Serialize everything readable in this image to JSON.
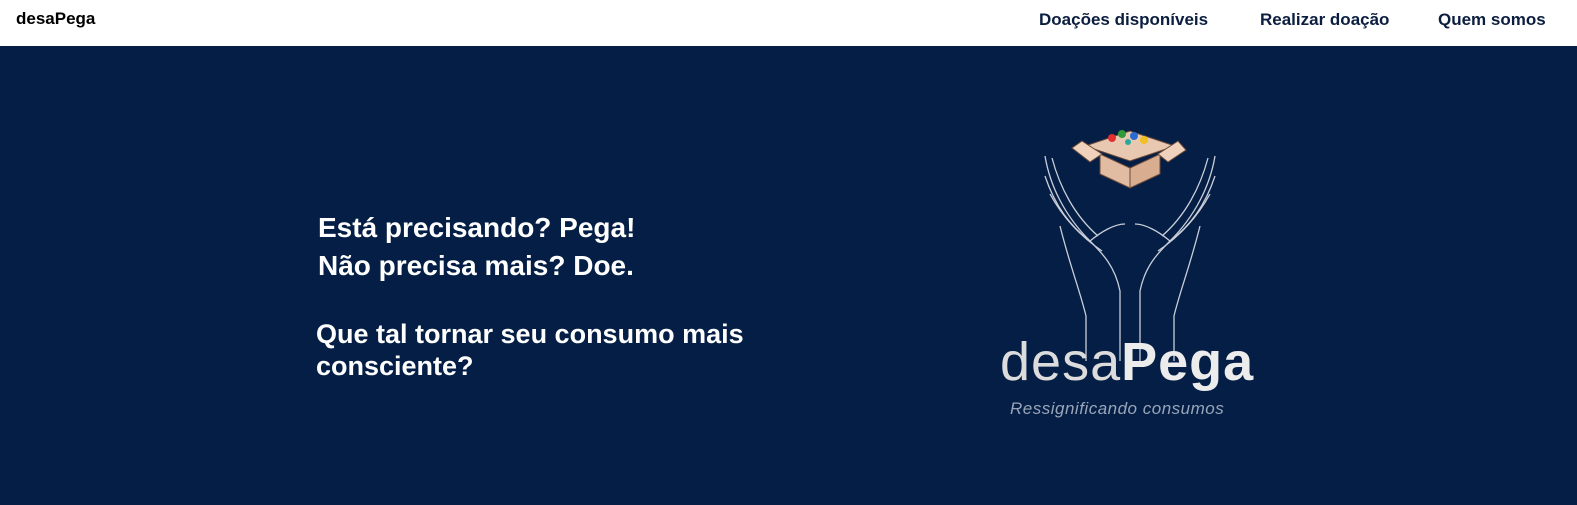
{
  "navbar": {
    "brand": "desaPega",
    "links": [
      "Doações disponíveis",
      "Realizar doação",
      "Quem somos"
    ]
  },
  "hero": {
    "headline_line1": "Está precisando? Pega!",
    "headline_line2": "Não precisa mais? Doe.",
    "subline": "Que tal tornar seu consumo mais consciente?"
  },
  "logo": {
    "word_light": "desa",
    "word_bold": "Pega",
    "tagline": "Ressignificando consumos"
  },
  "colors": {
    "hero_background": "#041e45",
    "nav_background": "#ffffff",
    "nav_link": "#0b1e3f"
  }
}
